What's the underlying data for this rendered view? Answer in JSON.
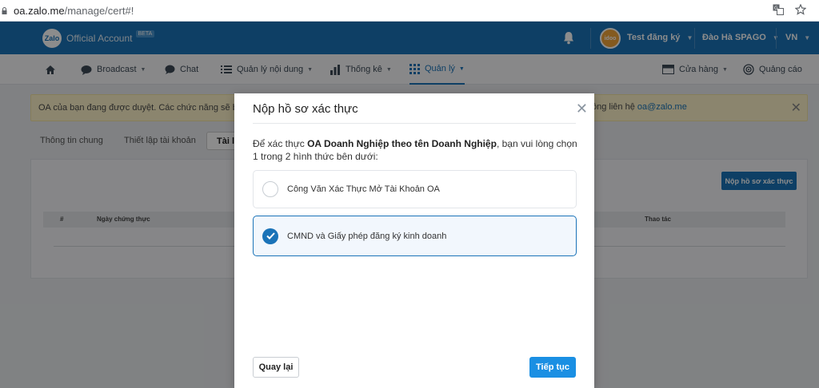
{
  "browser": {
    "url_host": "oa.zalo.me",
    "url_path": "/manage/cert#!"
  },
  "header": {
    "logo_mark": "Zalo",
    "product": "Official Account",
    "beta": "BETA",
    "avatar_text": "idoo",
    "account_name": "Test đăng ký",
    "user_name": "Đào Hà SPAGO",
    "language": "VN"
  },
  "nav": {
    "broadcast": "Broadcast",
    "chat": "Chat",
    "content": "Quản lý nội dung",
    "stats": "Thống kê",
    "manage": "Quản lý",
    "shop": "Cửa hàng",
    "ads": "Quảng cáo"
  },
  "page": {
    "alert_text": "OA của bạn đang được duyệt. Các chức năng sẽ bị kh",
    "alert_right": "ông liên hệ",
    "alert_email": "oa@zalo.me",
    "tab_general": "Thông tin chung",
    "tab_settings": "Thiết lập tài khoản",
    "tab_active": "Tài li",
    "submit_button": "Nộp hồ sơ xác thực",
    "col_number": "#",
    "col_date": "Ngày chứng thực",
    "col_actions": "Thao tác"
  },
  "modal": {
    "title": "Nộp hồ sơ xác thực",
    "desc_prefix": "Để xác thực ",
    "desc_bold": "OA Doanh Nghiệp theo tên Doanh Nghiệp",
    "desc_suffix": ", bạn vui lòng chọn 1 trong 2 hình thức bên dưới:",
    "options": [
      {
        "label": "Công Văn Xác Thực Mở Tài Khoản OA",
        "selected": false
      },
      {
        "label": "CMND và Giấy phép đăng ký kinh doanh",
        "selected": true
      }
    ],
    "back_button": "Quay lại",
    "next_button": "Tiếp tục"
  },
  "colors": {
    "brand_blue": "#1a73b8",
    "next_blue": "#1a8fe3",
    "alert_bg": "#fdf3c8"
  }
}
